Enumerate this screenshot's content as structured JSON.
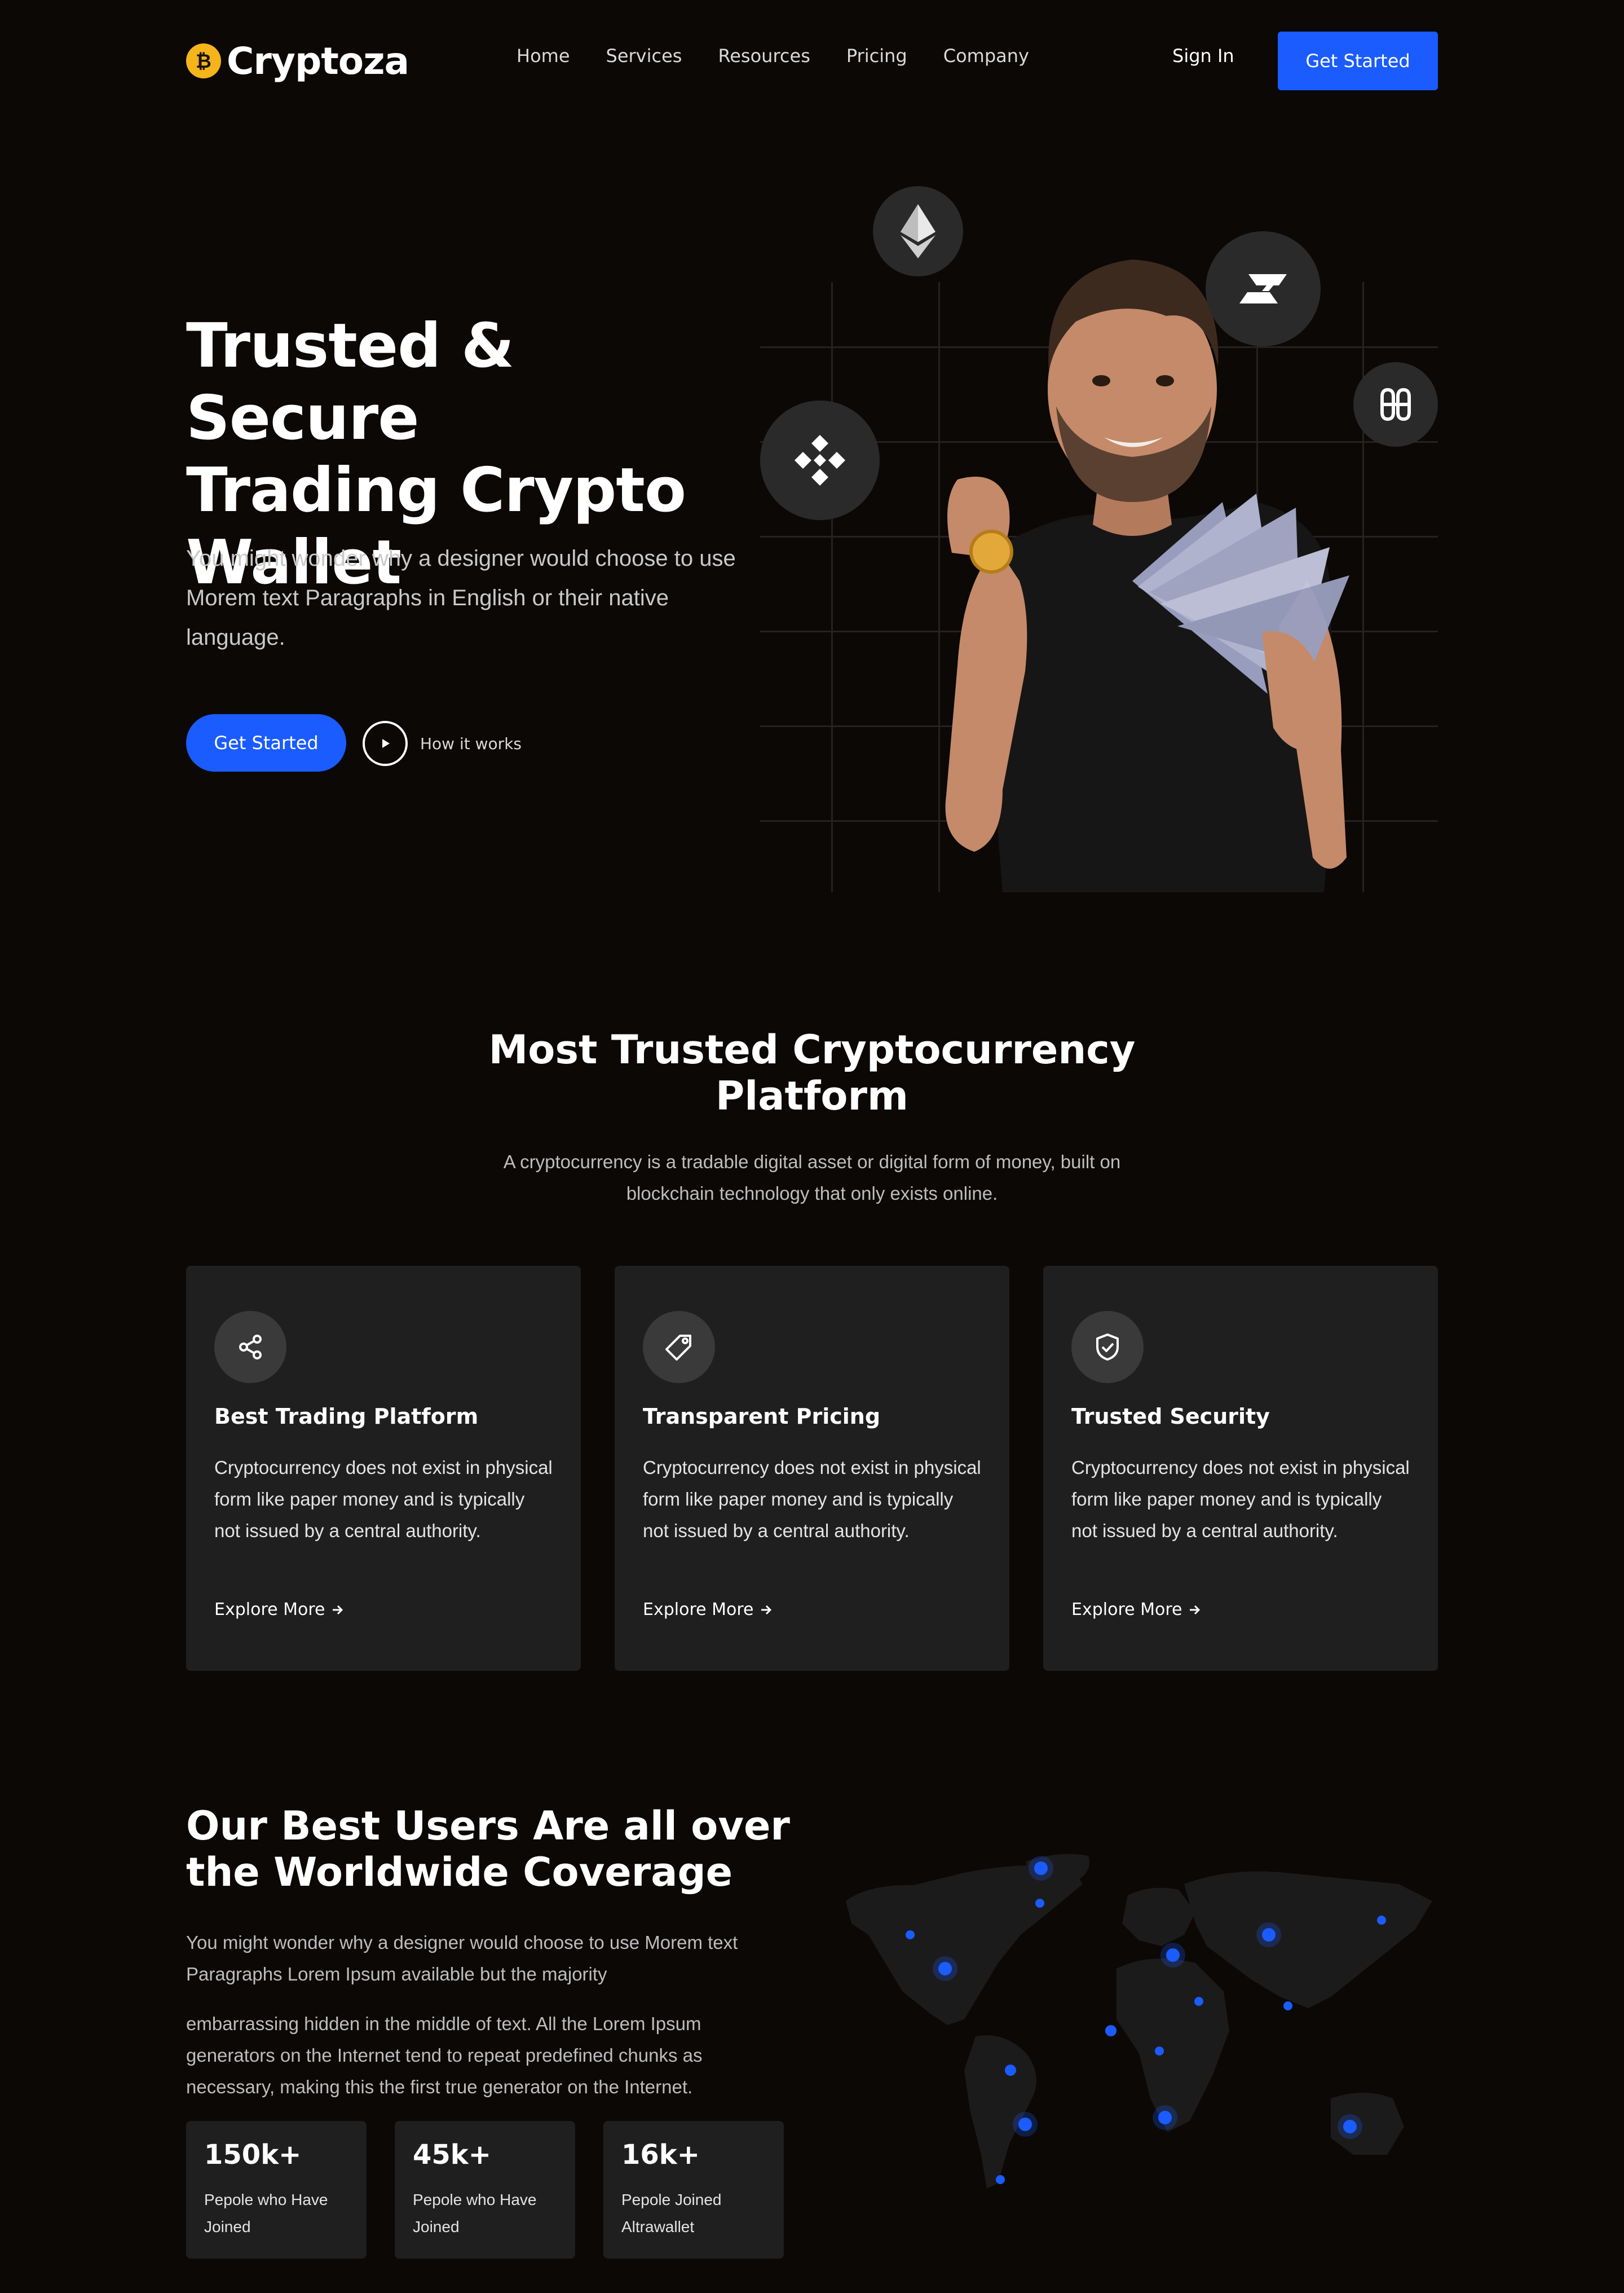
{
  "brand": {
    "name": "Cryptoza",
    "coin_symbol": "₿",
    "accent": "#f4b41a"
  },
  "nav": {
    "links": [
      "Home",
      "Services",
      "Resources",
      "Pricing",
      "Company"
    ],
    "sign_in": "Sign In",
    "cta": "Get Started"
  },
  "hero": {
    "title_lines": [
      "Trusted & Secure",
      "Trading Crypto",
      "Wallet"
    ],
    "description": "You might wonder why a designer would choose to use Morem text Paragraphs in English or their native language.",
    "cta": "Get Started",
    "secondary": "How it works",
    "tokens": [
      "ethereum-icon",
      "binance-icon",
      "horizen-icon",
      "harmony-icon"
    ]
  },
  "trusted": {
    "title": "Most Trusted Cryptocurrency Platform",
    "description": "A cryptocurrency is a tradable digital asset or digital form of money, built on blockchain technology that only exists online.",
    "cards": [
      {
        "icon": "share-icon",
        "title": "Best Trading Platform",
        "text": "Cryptocurrency does not exist in physical form like paper money and is typically not issued by a central authority.",
        "link": "Explore More"
      },
      {
        "icon": "tag-icon",
        "title": "Transparent Pricing",
        "text": "Cryptocurrency does not exist in physical form like paper money and is typically not issued by a central authority.",
        "link": "Explore More"
      },
      {
        "icon": "shield-check-icon",
        "title": "Trusted Security",
        "text": "Cryptocurrency does not exist in physical form like paper money and is typically not issued by a central authority.",
        "link": "Explore More"
      }
    ]
  },
  "worldwide": {
    "title": "Our Best Users Are all over the Worldwide Coverage",
    "paragraph_1": "You might wonder why a designer would choose to use Morem text Paragraphs Lorem Ipsum available but the majority",
    "paragraph_2": "embarrassing hidden in the middle of text. All the Lorem Ipsum generators on the Internet tend to repeat predefined chunks as necessary, making this the first true generator on the Internet.",
    "stats": [
      {
        "value": "150k+",
        "label": "Pepole who Have Joined"
      },
      {
        "value": "45k+",
        "label": "Pepole who Have Joined"
      },
      {
        "value": "16k+",
        "label": "Pepole Joined Altrawallet"
      }
    ]
  },
  "colors": {
    "primary": "#1a5cff",
    "background": "#0b0806",
    "card": "#1f1f20"
  }
}
